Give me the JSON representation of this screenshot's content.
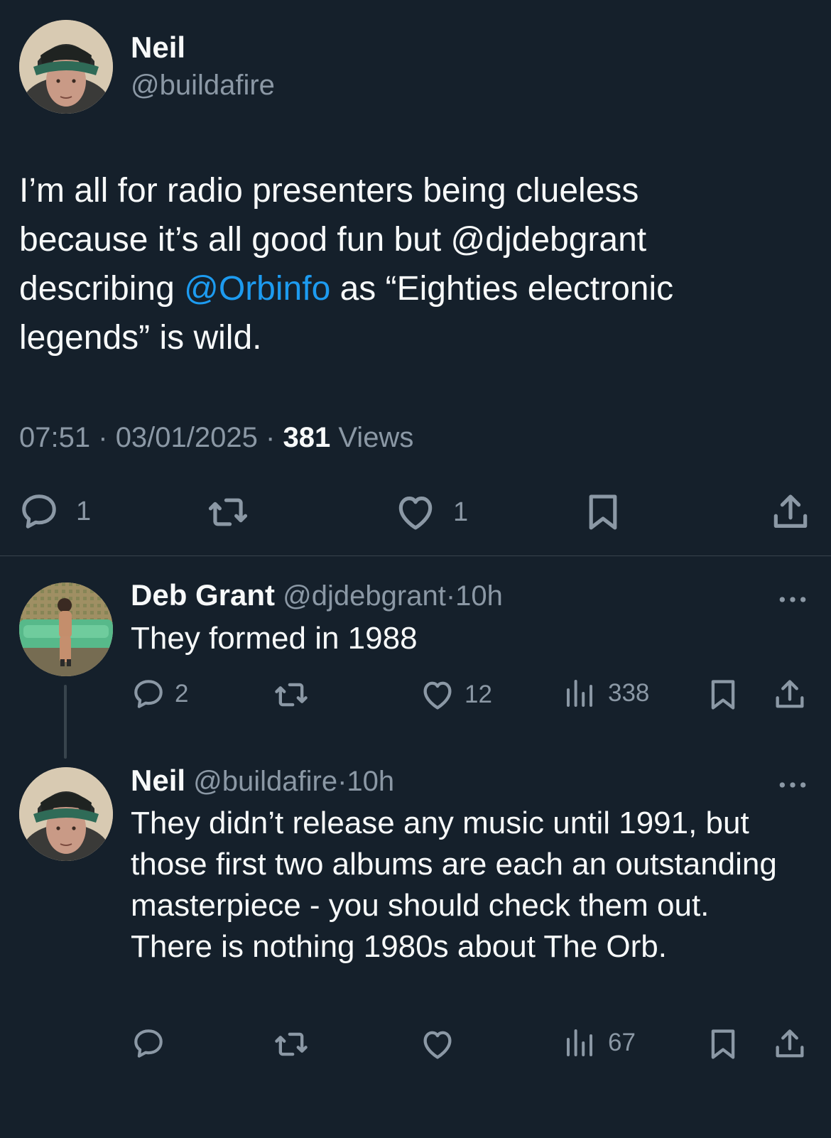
{
  "main_tweet": {
    "author_name": "Neil",
    "author_handle": "@buildafire",
    "text_before": "I’m all for radio presenters being clueless because it’s all good fun but @djdebgrant describing ",
    "mention": "@Orbinfo",
    "text_after": " as “Eighties electronic legends” is wild.",
    "time": "07:51",
    "sep1": "·",
    "date": "03/01/2025",
    "sep2": "·",
    "views_count": "381",
    "views_label": "Views",
    "reply_count": "1",
    "like_count": "1"
  },
  "reply1": {
    "author_name": "Deb Grant",
    "author_handle": "@djdebgrant",
    "sep": "·",
    "time": "10h",
    "text": "They formed in 1988",
    "reply_count": "2",
    "like_count": "12",
    "views_count": "338"
  },
  "reply2": {
    "author_name": "Neil",
    "author_handle": "@buildafire",
    "sep": "·",
    "time": "10h",
    "text": "They didn’t release any music until 1991, but those first two albums are each an outstanding masterpiece - you should check them out. There is nothing 1980s about The Orb.",
    "views_count": "67"
  },
  "colors": {
    "background": "#15202b",
    "text": "#f7f9f9",
    "muted": "#8b98a5",
    "link": "#1d9bf0",
    "divider": "#38444d"
  },
  "icons": [
    "reply-icon",
    "retweet-icon",
    "like-icon",
    "bookmark-icon",
    "share-icon",
    "views-icon",
    "more-icon"
  ]
}
